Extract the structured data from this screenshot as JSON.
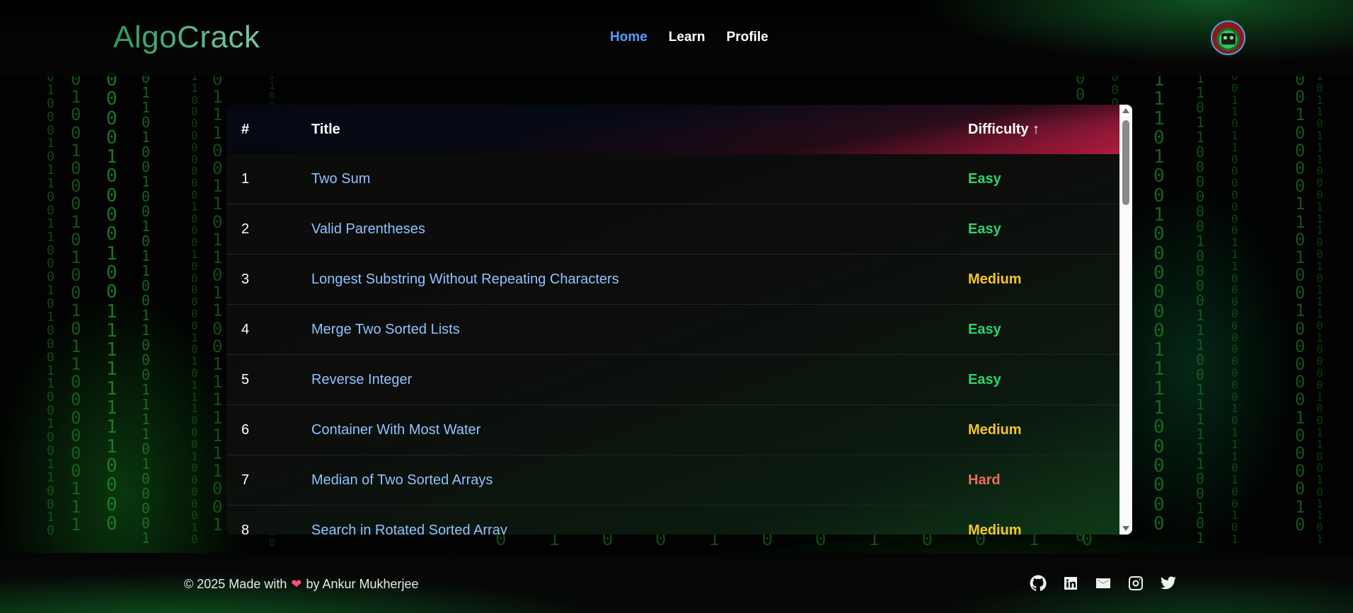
{
  "header": {
    "logo": "AlgoCrack",
    "nav": [
      {
        "label": "Home",
        "active": true
      },
      {
        "label": "Learn",
        "active": false
      },
      {
        "label": "Profile",
        "active": false
      }
    ],
    "avatar_icon": "zombie-avatar-icon"
  },
  "table": {
    "columns": {
      "number": "#",
      "title": "Title",
      "difficulty": "Difficulty ↑"
    },
    "rows": [
      {
        "number": "1",
        "title": "Two Sum",
        "difficulty": "Easy"
      },
      {
        "number": "2",
        "title": "Valid Parentheses",
        "difficulty": "Easy"
      },
      {
        "number": "3",
        "title": "Longest Substring Without Repeating Characters",
        "difficulty": "Medium"
      },
      {
        "number": "4",
        "title": "Merge Two Sorted Lists",
        "difficulty": "Easy"
      },
      {
        "number": "5",
        "title": "Reverse Integer",
        "difficulty": "Easy"
      },
      {
        "number": "6",
        "title": "Container With Most Water",
        "difficulty": "Medium"
      },
      {
        "number": "7",
        "title": "Median of Two Sorted Arrays",
        "difficulty": "Hard"
      },
      {
        "number": "8",
        "title": "Search in Rotated Sorted Array",
        "difficulty": "Medium"
      }
    ],
    "difficulty_colors": {
      "Easy": "#2fd36a",
      "Medium": "#f4c52b",
      "Hard": "#f06b5c"
    }
  },
  "footer": {
    "copyright_prefix": "© 2025 Made with",
    "heart": "❤",
    "copyright_suffix": "by Ankur Mukherjee",
    "socials": [
      "github-icon",
      "linkedin-icon",
      "mail-icon",
      "instagram-icon",
      "twitter-icon"
    ]
  },
  "colors": {
    "accent_blue": "#5b9cf5",
    "link_blue": "#8ec2ff",
    "logo_green": "#3aa86a",
    "header_red": "#e82a54"
  }
}
